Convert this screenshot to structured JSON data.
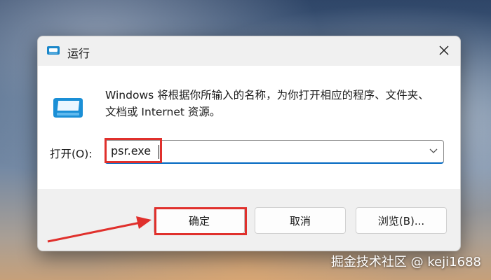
{
  "window": {
    "title": "运行",
    "close_icon": "close-icon",
    "app_icon": "run-app-icon"
  },
  "content": {
    "description": "Windows 将根据你所输入的名称，为你打开相应的程序、文件夹、文档或 Internet 资源。",
    "open_label": "打开(O):",
    "open_value": "psr.exe",
    "dropdown_icon": "chevron-down-icon"
  },
  "buttons": {
    "ok": "确定",
    "cancel": "取消",
    "browse": "浏览(B)..."
  },
  "annotations": {
    "highlight_color": "#e0302c"
  },
  "watermark": "掘金技术社区 @ keji1688"
}
